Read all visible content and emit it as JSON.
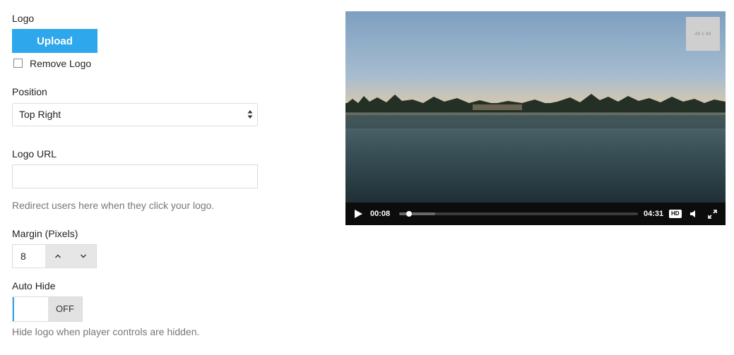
{
  "logo": {
    "label": "Logo",
    "upload_button": "Upload",
    "remove_checkbox_label": "Remove Logo",
    "remove_checked": false
  },
  "position": {
    "label": "Position",
    "selected": "Top Right"
  },
  "logo_url": {
    "label": "Logo URL",
    "value": "",
    "help": "Redirect users here when they click your logo."
  },
  "margin": {
    "label": "Margin (Pixels)",
    "value": "8"
  },
  "auto_hide": {
    "label": "Auto Hide",
    "state": "OFF",
    "help": "Hide logo when player controls are hidden."
  },
  "player": {
    "logo_placeholder": "48 x 48",
    "current_time": "00:08",
    "duration": "04:31",
    "progress_fraction": 0.03,
    "buffered_fraction": 0.15,
    "hd_label": "HD",
    "icons": [
      "play-icon",
      "volume-icon",
      "fullscreen-icon"
    ]
  },
  "colors": {
    "accent": "#2ea7ec",
    "control_bar": "#0c0c0c"
  }
}
